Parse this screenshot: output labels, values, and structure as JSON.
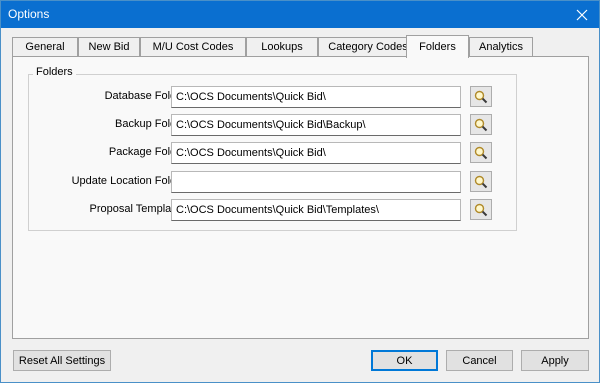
{
  "window": {
    "title": "Options"
  },
  "tabs": [
    {
      "label": "General"
    },
    {
      "label": "New Bid"
    },
    {
      "label": "M/U Cost Codes"
    },
    {
      "label": "Lookups"
    },
    {
      "label": "Category Codes"
    },
    {
      "label": "Folders",
      "active": true
    },
    {
      "label": "Analytics"
    }
  ],
  "folders": {
    "legend": "Folders",
    "rows": [
      {
        "label": "Database Folder:",
        "value": "C:\\OCS Documents\\Quick Bid\\"
      },
      {
        "label": "Backup Folder:",
        "value": "C:\\OCS Documents\\Quick Bid\\Backup\\"
      },
      {
        "label": "Package Folder:",
        "value": "C:\\OCS Documents\\Quick Bid\\"
      },
      {
        "label": "Update Location Folder:",
        "value": ""
      },
      {
        "label": "Proposal Templates:",
        "value": "C:\\OCS Documents\\Quick Bid\\Templates\\"
      }
    ],
    "browse_icon": "magnifier-icon"
  },
  "footer": {
    "reset_label": "Reset All Settings",
    "ok_label": "OK",
    "cancel_label": "Cancel",
    "apply_label": "Apply"
  },
  "colors": {
    "titlebar": "#0a6fd0",
    "default_button_border": "#0078d7"
  }
}
